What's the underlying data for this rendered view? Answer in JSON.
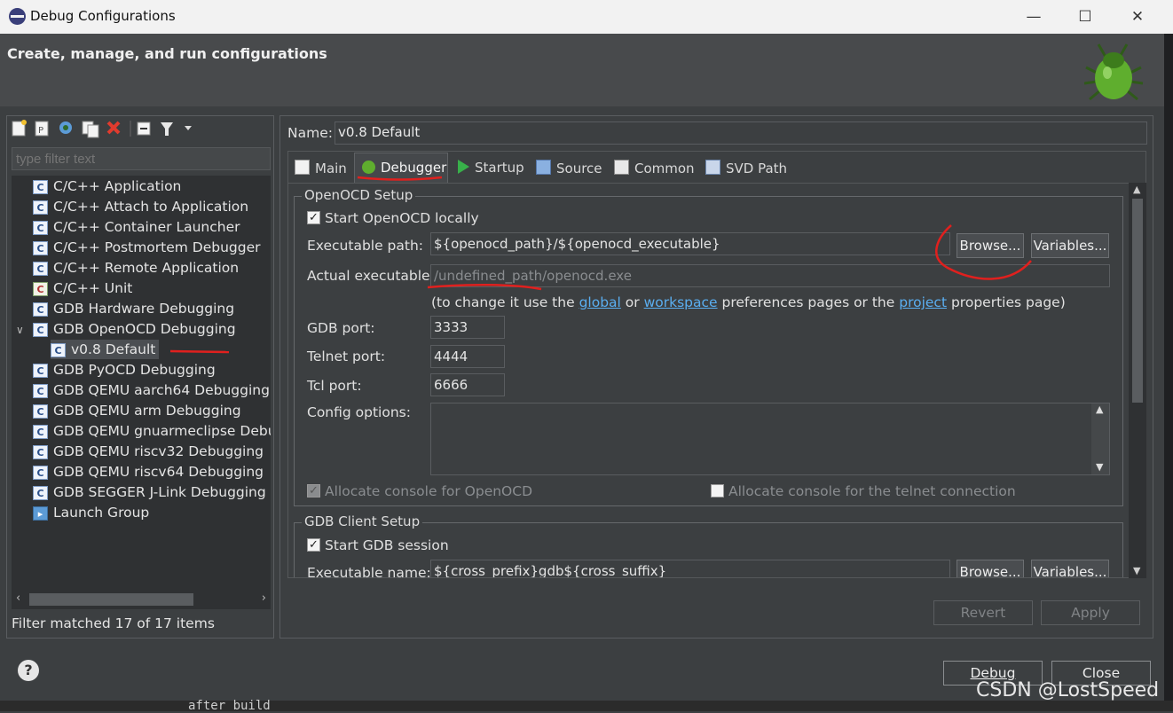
{
  "window": {
    "title": "Debug Configurations",
    "minimize": "—",
    "maximize": "☐",
    "close": "✕"
  },
  "header": {
    "title": "Create, manage, and run configurations"
  },
  "left": {
    "filter_placeholder": "type filter text",
    "tree": [
      {
        "label": "C/C++ Application",
        "level": 0
      },
      {
        "label": "C/C++ Attach to Application",
        "level": 0
      },
      {
        "label": "C/C++ Container Launcher",
        "level": 0
      },
      {
        "label": "C/C++ Postmortem Debugger",
        "level": 0
      },
      {
        "label": "C/C++ Remote Application",
        "level": 0
      },
      {
        "label": "C/C++ Unit",
        "level": 0
      },
      {
        "label": "GDB Hardware Debugging",
        "level": 0
      },
      {
        "label": "GDB OpenOCD Debugging",
        "level": 0,
        "expanded": true
      },
      {
        "label": "v0.8 Default",
        "level": 1,
        "selected": true
      },
      {
        "label": "GDB PyOCD Debugging",
        "level": 0
      },
      {
        "label": "GDB QEMU aarch64 Debugging",
        "level": 0
      },
      {
        "label": "GDB QEMU arm Debugging",
        "level": 0
      },
      {
        "label": "GDB QEMU gnuarmeclipse Debugging",
        "level": 0
      },
      {
        "label": "GDB QEMU riscv32 Debugging",
        "level": 0
      },
      {
        "label": "GDB QEMU riscv64 Debugging",
        "level": 0
      },
      {
        "label": "GDB SEGGER J-Link Debugging",
        "level": 0
      },
      {
        "label": "Launch Group",
        "level": 0
      }
    ],
    "status": "Filter matched 17 of 17 items"
  },
  "right": {
    "name_label": "Name:",
    "name_value": "v0.8 Default",
    "tabs": [
      "Main",
      "Debugger",
      "Startup",
      "Source",
      "Common",
      "SVD Path"
    ],
    "active_tab": "Debugger",
    "openocd": {
      "group": "OpenOCD Setup",
      "start_locally": "Start OpenOCD locally",
      "exec_label": "Executable path:",
      "exec_value": "${openocd_path}/${openocd_executable}",
      "browse": "Browse...",
      "variables": "Variables...",
      "actual_label": "Actual executable:",
      "actual_value": "/undefined_path/openocd.exe",
      "hint_pre": "(to change it use the",
      "hint_global": "global",
      "hint_or": "or",
      "hint_workspace": "workspace",
      "hint_mid": "preferences pages or the",
      "hint_project": "project",
      "hint_post": "properties page)",
      "gdb_port_label": "GDB port:",
      "gdb_port": "3333",
      "telnet_label": "Telnet port:",
      "telnet_port": "4444",
      "tcl_label": "Tcl port:",
      "tcl_port": "6666",
      "config_label": "Config options:",
      "alloc_console": "Allocate console for OpenOCD",
      "alloc_telnet": "Allocate console for the telnet connection"
    },
    "gdb_client": {
      "group": "GDB Client Setup",
      "start_session": "Start GDB session",
      "exec_label": "Executable name:",
      "exec_value": "${cross_prefix}gdb${cross_suffix}",
      "browse": "Browse...",
      "variables": "Variables..."
    },
    "revert": "Revert",
    "apply": "Apply"
  },
  "footer": {
    "help": "?",
    "debug": "Debug",
    "close": "Close"
  },
  "watermark": "CSDN @LostSpeed",
  "background_text": "after build",
  "colors": {
    "annotation": "#e0201e",
    "link": "#5aaef0"
  }
}
